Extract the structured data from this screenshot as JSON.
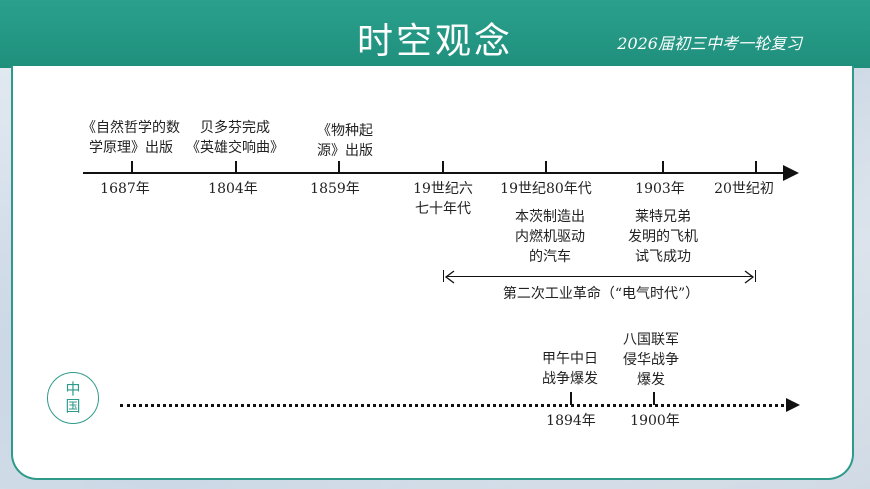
{
  "header": {
    "title": "时空观念",
    "subtitle": "2026届初三中考一轮复习"
  },
  "timeline": {
    "years": [
      "1687年",
      "1804年",
      "1859年",
      "19世纪六",
      "七十年代",
      "19世纪80年代",
      "1903年",
      "20世纪初"
    ],
    "top_events": [
      {
        "line1": "《自然哲学的数",
        "line2": "学原理》出版"
      },
      {
        "line1": "贝多芬完成",
        "line2": "《英雄交响曲》"
      },
      {
        "line1": "《物种起",
        "line2": "源》出版"
      }
    ],
    "bottom_events": [
      {
        "line1": "本茨制造出",
        "line2": "内燃机驱动",
        "line3": "的汽车"
      },
      {
        "line1": "莱特兄弟",
        "line2": "发明的飞机",
        "line3": "试飞成功"
      }
    ],
    "range_label": "第二次工业革命（“电气时代”）"
  },
  "china": {
    "label": "中国",
    "events": [
      {
        "line1": "甲午中日",
        "line2": "战争爆发"
      },
      {
        "line1": "八国联军",
        "line2": "侵华战争",
        "line3": "爆发"
      }
    ],
    "years": [
      "1894年",
      "1900年"
    ]
  }
}
